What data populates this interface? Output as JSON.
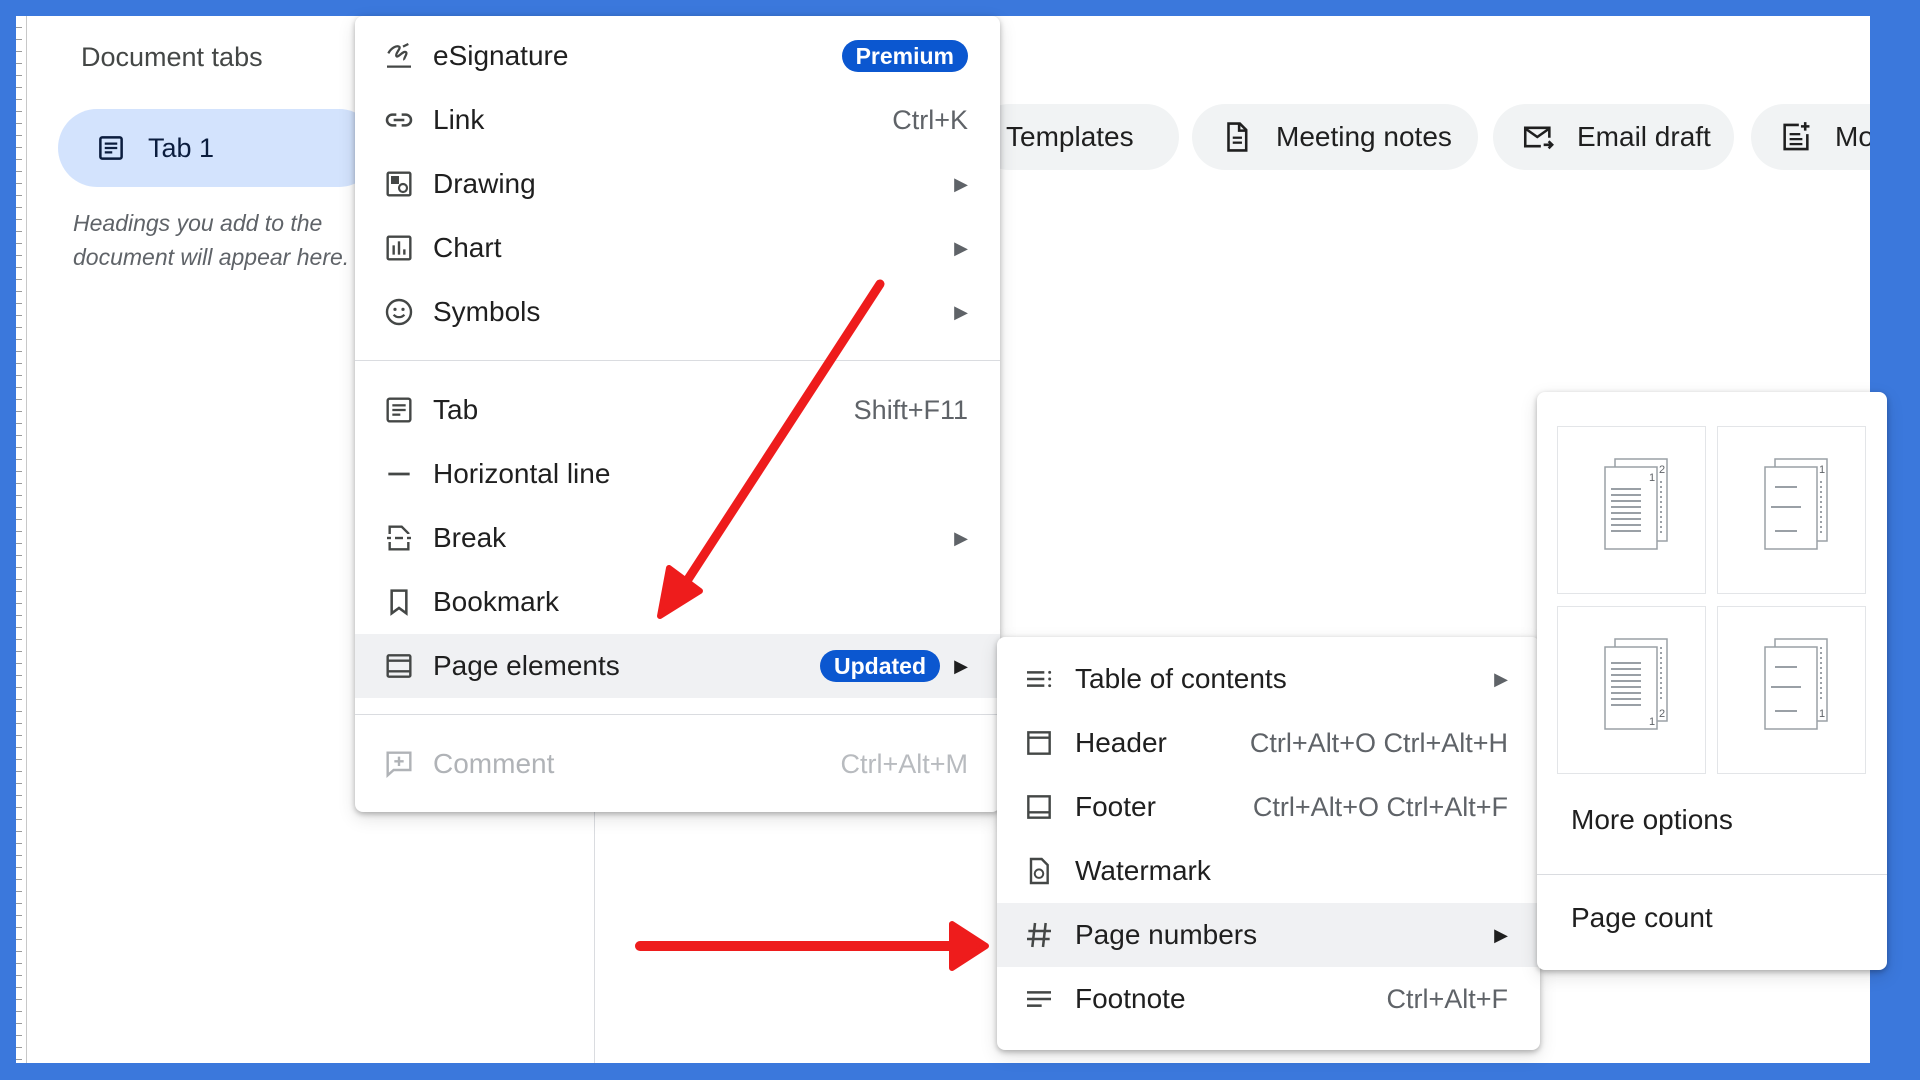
{
  "sidebar": {
    "title": "Document tabs",
    "tab": {
      "label": "Tab 1",
      "icon": "document-tab-icon"
    },
    "hint": "Headings you add to the document will appear here."
  },
  "chips": [
    {
      "label": "Templates",
      "icon": ""
    },
    {
      "label": "Meeting notes",
      "icon": "document-icon"
    },
    {
      "label": "Email draft",
      "icon": "email-icon"
    },
    {
      "label": "More",
      "icon": "add-document-icon"
    }
  ],
  "insert_menu": {
    "items": [
      {
        "label": "eSignature",
        "badge": "Premium",
        "icon": "signature-icon"
      },
      {
        "label": "Link",
        "shortcut": "Ctrl+K",
        "icon": "link-icon"
      },
      {
        "label": "Drawing",
        "submenu": true,
        "icon": "drawing-icon"
      },
      {
        "label": "Chart",
        "submenu": true,
        "icon": "chart-icon"
      },
      {
        "label": "Symbols",
        "submenu": true,
        "icon": "smiley-icon"
      },
      {
        "label": "Tab",
        "shortcut": "Shift+F11",
        "icon": "tab-icon"
      },
      {
        "label": "Horizontal line",
        "icon": "horizontal-line-icon"
      },
      {
        "label": "Break",
        "submenu": true,
        "icon": "break-icon"
      },
      {
        "label": "Bookmark",
        "icon": "bookmark-icon"
      },
      {
        "label": "Page elements",
        "badge": "Updated",
        "submenu": true,
        "highlighted": true,
        "icon": "page-elements-icon"
      },
      {
        "label": "Comment",
        "shortcut": "Ctrl+Alt+M",
        "disabled": true,
        "icon": "comment-add-icon"
      }
    ]
  },
  "page_elements_menu": {
    "items": [
      {
        "label": "Table of contents",
        "submenu": true,
        "icon": "toc-icon"
      },
      {
        "label": "Header",
        "shortcut": "Ctrl+Alt+O Ctrl+Alt+H",
        "icon": "header-icon"
      },
      {
        "label": "Footer",
        "shortcut": "Ctrl+Alt+O Ctrl+Alt+F",
        "icon": "footer-icon"
      },
      {
        "label": "Watermark",
        "icon": "watermark-icon"
      },
      {
        "label": "Page numbers",
        "submenu": true,
        "highlighted": true,
        "icon": "hash-icon"
      },
      {
        "label": "Footnote",
        "shortcut": "Ctrl+Alt+F",
        "icon": "footnote-icon"
      }
    ]
  },
  "page_numbers_menu": {
    "options": [
      {
        "numbers": [
          "1",
          "2"
        ],
        "icon": "page-number-top-right-all-pages-icon"
      },
      {
        "numbers": [
          "1"
        ],
        "icon": "page-number-top-right-skip-first-icon"
      },
      {
        "numbers": [
          "1",
          "2"
        ],
        "icon": "page-number-bottom-right-all-pages-icon"
      },
      {
        "numbers": [
          "1"
        ],
        "icon": "page-number-bottom-right-skip-first-icon"
      }
    ],
    "more_options": "More options",
    "page_count": "Page count"
  },
  "colors": {
    "frame": "#3b78dc",
    "accent": "#0b57d0",
    "tab_selected": "#d3e3fd",
    "annotation_arrow": "#ee1c1c"
  }
}
